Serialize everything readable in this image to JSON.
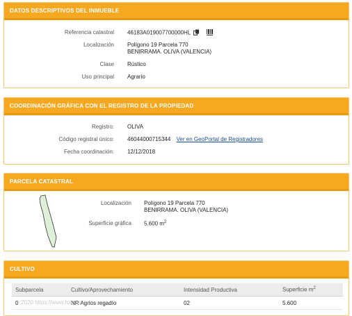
{
  "datos": {
    "header": "DATOS DESCRIPTIVOS DEL INMUEBLE",
    "rows": [
      {
        "label": "Referencia catastral",
        "value": "46183A019007700000HL"
      },
      {
        "label": "Localización",
        "value": "Polígono 19 Parcela 770",
        "value2": "BENIRRAMA. OLIVA (VALENCIA)"
      },
      {
        "label": "Clase",
        "value": "Rústico"
      },
      {
        "label": "Uso principal",
        "value": "Agrario"
      }
    ]
  },
  "coordinacion": {
    "header": "COORDINACIÓN GRÁFICA CON EL REGISTRO DE LA PROPIEDAD",
    "rows": [
      {
        "label": "Registro:",
        "value": "OLIVA"
      },
      {
        "label": "Código registral único:",
        "value": "46044000715344",
        "link": "Ver en GeoPortal de Registradores"
      },
      {
        "label": "Fecha coordinación:",
        "value": "12/12/2018"
      }
    ]
  },
  "parcela": {
    "header": "PARCELA CATASTRAL",
    "rows": [
      {
        "label": "Localización",
        "value": "Polígono 19 Parcela 770",
        "value2": "BENIRRAMA. OLIVA (VALENCIA)"
      },
      {
        "label": "Superficie gráfica",
        "value": "5.600 m",
        "sup": "2"
      }
    ]
  },
  "cultivo": {
    "header": "CULTIVO",
    "columns": [
      "Subparcela",
      "Cultivo/Aprovechamiento",
      "Intensidad Productiva",
      "Superficie m"
    ],
    "columns_sup": "2",
    "rows": [
      [
        "0",
        "NR Agrios regadío",
        "02",
        "5.600"
      ]
    ]
  },
  "watermark": "© 2020 https://www.fotocasa.es",
  "colors": {
    "header_bg": "#f5a820",
    "link": "#1a4b8c",
    "parcel_fill": "#dff0d8"
  }
}
